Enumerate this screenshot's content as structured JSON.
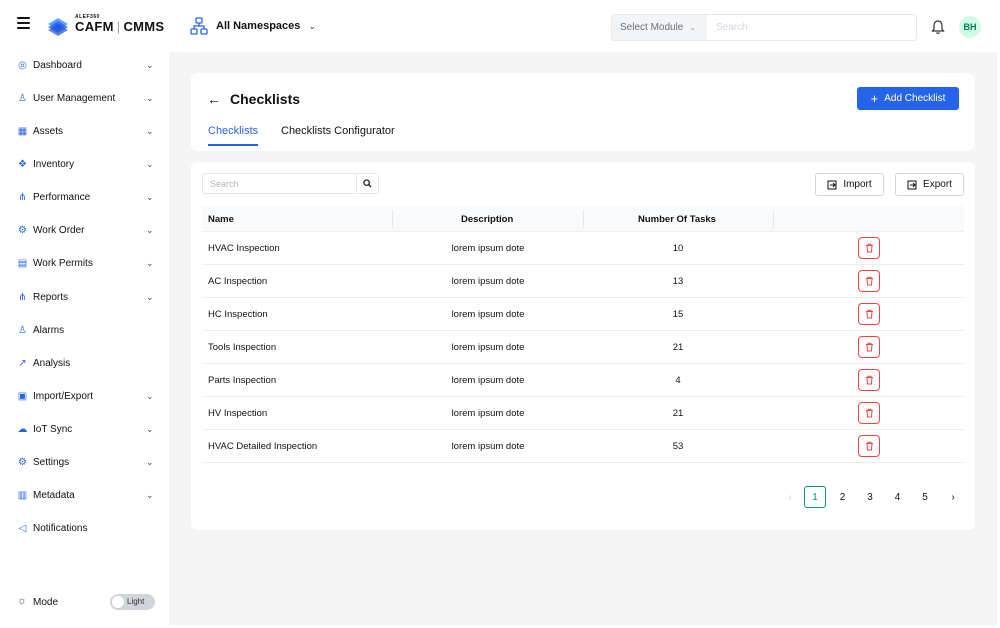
{
  "app": {
    "logo_subtitle": "ALEF360",
    "logo_name": "CAFM",
    "logo_separator": "|",
    "logo_product": "CMMS",
    "namespace_label": "All Namespaces",
    "module_select": "Select Module",
    "search_placeholder": "Search",
    "avatar_initials": "BH"
  },
  "sidebar": {
    "items": [
      {
        "label": "Dashboard",
        "icon": "dashboard-icon",
        "glyph": "◎",
        "chevron": true
      },
      {
        "label": "User Management",
        "icon": "user-icon",
        "glyph": "♙",
        "chevron": true
      },
      {
        "label": "Assets",
        "icon": "grid-icon",
        "glyph": "▦",
        "chevron": true
      },
      {
        "label": "Inventory",
        "icon": "boxes-icon",
        "glyph": "❖",
        "chevron": true
      },
      {
        "label": "Performance",
        "icon": "network-icon",
        "glyph": "⋔",
        "chevron": true
      },
      {
        "label": "Work Order",
        "icon": "workorder-icon",
        "glyph": "⚙",
        "chevron": true
      },
      {
        "label": "Work Permits",
        "icon": "document-icon",
        "glyph": "▤",
        "chevron": true
      },
      {
        "label": "Reports",
        "icon": "reports-icon",
        "glyph": "⋔",
        "chevron": true
      },
      {
        "label": "Alarms",
        "icon": "alarm-icon",
        "glyph": "♙",
        "chevron": false
      },
      {
        "label": "Analysis",
        "icon": "chart-icon",
        "glyph": "↗",
        "chevron": false
      },
      {
        "label": "Import/Export",
        "icon": "import-export-icon",
        "glyph": "▣",
        "chevron": true
      },
      {
        "label": "IoT Sync",
        "icon": "sync-icon",
        "glyph": "☁",
        "chevron": true
      },
      {
        "label": "Settings",
        "icon": "gear-icon",
        "glyph": "⚙",
        "chevron": true
      },
      {
        "label": "Metadata",
        "icon": "bar-chart-icon",
        "glyph": "▥",
        "chevron": true
      },
      {
        "label": "Notifications",
        "icon": "megaphone-icon",
        "glyph": "◁",
        "chevron": false
      }
    ],
    "mode_label": "Mode",
    "mode_value": "Light"
  },
  "header": {
    "title": "Checklists",
    "add_button": "Add Checklist",
    "tabs": [
      {
        "label": "Checklists",
        "active": true
      },
      {
        "label": "Checklists Configurator",
        "active": false
      }
    ]
  },
  "table": {
    "search_placeholder": "Search",
    "import_label": "Import",
    "export_label": "Export",
    "columns": [
      "Name",
      "Description",
      "Number Of Tasks"
    ],
    "rows": [
      {
        "name": "HVAC Inspection",
        "description": "lorem ipsum dote",
        "tasks": "10"
      },
      {
        "name": "AC Inspection",
        "description": "lorem ipsum dote",
        "tasks": "13"
      },
      {
        "name": "HC Inspection",
        "description": "lorem ipsum dote",
        "tasks": "15"
      },
      {
        "name": "Tools Inspection",
        "description": "lorem ipsum dote",
        "tasks": "21"
      },
      {
        "name": "Parts Inspection",
        "description": "lorem ipsum dote",
        "tasks": "4"
      },
      {
        "name": "HV Inspection",
        "description": "lorem ipsum dote",
        "tasks": "21"
      },
      {
        "name": "HVAC Detailed Inspection",
        "description": "lorem ipsum dote",
        "tasks": "53"
      }
    ]
  },
  "pagination": {
    "prev": "‹",
    "pages": [
      "1",
      "2",
      "3",
      "4",
      "5"
    ],
    "current": "1",
    "next": "›"
  },
  "colors": {
    "primary": "#2563eb",
    "danger": "#ef4444",
    "page_active": "#059669",
    "main_bg": "#f3f4f3"
  }
}
